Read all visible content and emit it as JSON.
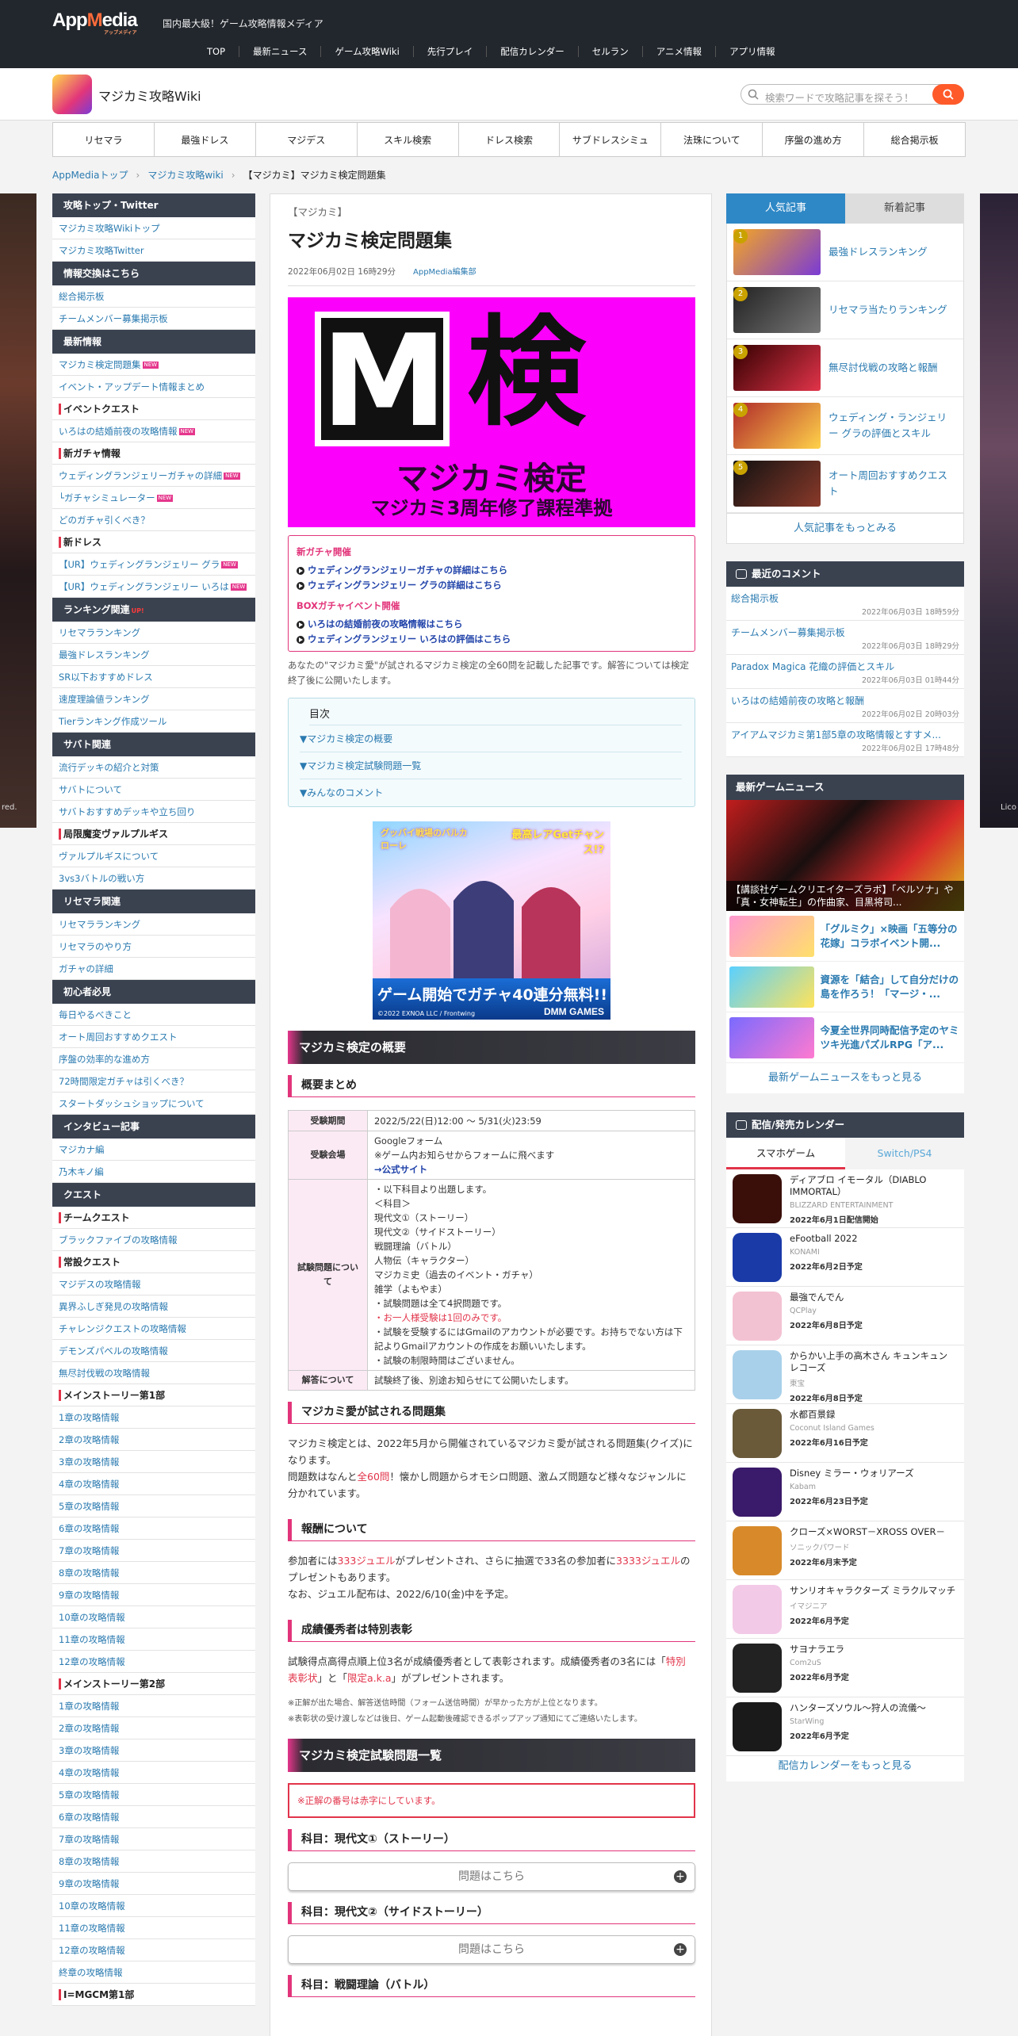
{
  "header": {
    "logo": "AppMedia",
    "logo_sub": "アップメディア",
    "tagline": "国内最大級！ゲーム攻略情報メディア",
    "nav": [
      "TOP",
      "最新ニュース",
      "ゲーム攻略Wiki",
      "先行プレイ",
      "配信カレンダー",
      "セルラン",
      "アニメ情報",
      "アプリ情報"
    ]
  },
  "site": {
    "title": "マジカミ攻略Wiki",
    "search_placeholder": "検索ワードで攻略記事を探そう！"
  },
  "wikinav": [
    "リセマラ",
    "最強ドレス",
    "マジデス",
    "スキル検索",
    "ドレス検索",
    "サブドレスシミュ",
    "法珠について",
    "序盤の進め方",
    "総合掲示板"
  ],
  "breadcrumb": [
    "AppMediaトップ",
    "マジカミ攻略wiki",
    "【マジカミ】マジカミ検定問題集"
  ],
  "art": {
    "left": "red.",
    "right": "Lico"
  },
  "left": [
    {
      "t": "h",
      "v": "攻略トップ・Twitter"
    },
    {
      "t": "l",
      "v": "マジカミ攻略Wikiトップ"
    },
    {
      "t": "l",
      "v": "マジカミ攻略Twitter"
    },
    {
      "t": "h",
      "v": "情報交換はこちら"
    },
    {
      "t": "l",
      "v": "総合掲示板"
    },
    {
      "t": "l",
      "v": "チームメンバー募集掲示板"
    },
    {
      "t": "h",
      "v": "最新情報"
    },
    {
      "t": "l",
      "v": "マジカミ検定問題集",
      "n": 1
    },
    {
      "t": "l",
      "v": "イベント・アップデート情報まとめ"
    },
    {
      "t": "s",
      "v": "イベントクエスト"
    },
    {
      "t": "l",
      "v": "いろはの結婚前夜の攻略情報",
      "n": 1
    },
    {
      "t": "s",
      "v": "新ガチャ情報"
    },
    {
      "t": "l",
      "v": "ウェディングランジェリーガチャの詳細",
      "n": 1
    },
    {
      "t": "l",
      "v": "└ガチャシミュレーター",
      "n": 1
    },
    {
      "t": "l",
      "v": "どのガチャ引くべき？"
    },
    {
      "t": "s",
      "v": "新ドレス"
    },
    {
      "t": "l",
      "v": "【UR】ウェディングランジェリー グラ",
      "n": 1
    },
    {
      "t": "l",
      "v": "【UR】ウェディングランジェリー いろは",
      "n": 1
    },
    {
      "t": "h",
      "v": "ランキング関連",
      "u": "UP!"
    },
    {
      "t": "l",
      "v": "リセマラランキング"
    },
    {
      "t": "l",
      "v": "最強ドレスランキング"
    },
    {
      "t": "l",
      "v": "SR以下おすすめドレス"
    },
    {
      "t": "l",
      "v": "速度理論値ランキング"
    },
    {
      "t": "l",
      "v": "Tierランキング作成ツール"
    },
    {
      "t": "h",
      "v": "サバト関連"
    },
    {
      "t": "l",
      "v": "流行デッキの紹介と対策"
    },
    {
      "t": "l",
      "v": "サバトについて"
    },
    {
      "t": "l",
      "v": "サバトおすすめデッキや立ち回り"
    },
    {
      "t": "s",
      "v": "局限魔変ヴァルプルギス"
    },
    {
      "t": "l",
      "v": "ヴァルプルギスについて"
    },
    {
      "t": "l",
      "v": "3vs3バトルの戦い方"
    },
    {
      "t": "h",
      "v": "リセマラ関連"
    },
    {
      "t": "l",
      "v": "リセマラランキング"
    },
    {
      "t": "l",
      "v": "リセマラのやり方"
    },
    {
      "t": "l",
      "v": "ガチャの詳細"
    },
    {
      "t": "h",
      "v": "初心者必見"
    },
    {
      "t": "l",
      "v": "毎日やるべきこと"
    },
    {
      "t": "l",
      "v": "オート周回おすすめクエスト"
    },
    {
      "t": "l",
      "v": "序盤の効率的な進め方"
    },
    {
      "t": "l",
      "v": "72時間限定ガチャは引くべき？"
    },
    {
      "t": "l",
      "v": "スタートダッシュショップについて"
    },
    {
      "t": "h",
      "v": "インタビュー記事"
    },
    {
      "t": "l",
      "v": "マジカナ編"
    },
    {
      "t": "l",
      "v": "乃木キノ編"
    },
    {
      "t": "h",
      "v": "クエスト"
    },
    {
      "t": "s",
      "v": "チームクエスト"
    },
    {
      "t": "l",
      "v": "ブラックファイブの攻略情報"
    },
    {
      "t": "s",
      "v": "常設クエスト"
    },
    {
      "t": "l",
      "v": "マジデスの攻略情報"
    },
    {
      "t": "l",
      "v": "異界ふしぎ発見の攻略情報"
    },
    {
      "t": "l",
      "v": "チャレンジクエストの攻略情報"
    },
    {
      "t": "l",
      "v": "デモンズパベルの攻略情報"
    },
    {
      "t": "l",
      "v": "無尽討伐戦の攻略情報"
    },
    {
      "t": "s",
      "v": "メインストーリー第1部"
    },
    {
      "t": "l",
      "v": "1章の攻略情報"
    },
    {
      "t": "l",
      "v": "2章の攻略情報"
    },
    {
      "t": "l",
      "v": "3章の攻略情報"
    },
    {
      "t": "l",
      "v": "4章の攻略情報"
    },
    {
      "t": "l",
      "v": "5章の攻略情報"
    },
    {
      "t": "l",
      "v": "6章の攻略情報"
    },
    {
      "t": "l",
      "v": "7章の攻略情報"
    },
    {
      "t": "l",
      "v": "8章の攻略情報"
    },
    {
      "t": "l",
      "v": "9章の攻略情報"
    },
    {
      "t": "l",
      "v": "10章の攻略情報"
    },
    {
      "t": "l",
      "v": "11章の攻略情報"
    },
    {
      "t": "l",
      "v": "12章の攻略情報"
    },
    {
      "t": "s",
      "v": "メインストーリー第2部"
    },
    {
      "t": "l",
      "v": "1章の攻略情報"
    },
    {
      "t": "l",
      "v": "2章の攻略情報"
    },
    {
      "t": "l",
      "v": "3章の攻略情報"
    },
    {
      "t": "l",
      "v": "4章の攻略情報"
    },
    {
      "t": "l",
      "v": "5章の攻略情報"
    },
    {
      "t": "l",
      "v": "6章の攻略情報"
    },
    {
      "t": "l",
      "v": "7章の攻略情報"
    },
    {
      "t": "l",
      "v": "8章の攻略情報"
    },
    {
      "t": "l",
      "v": "9章の攻略情報"
    },
    {
      "t": "l",
      "v": "10章の攻略情報"
    },
    {
      "t": "l",
      "v": "11章の攻略情報"
    },
    {
      "t": "l",
      "v": "12章の攻略情報"
    },
    {
      "t": "l",
      "v": "終章の攻略情報"
    },
    {
      "t": "s",
      "v": "I=MGCM第1部"
    }
  ],
  "article": {
    "category": "【マジカミ】",
    "title": "マジカミ検定問題集",
    "date": "2022年06月02日 16時29分",
    "author": "AppMedia編集部",
    "hero": {
      "m": "M",
      "k": "検",
      "t1": "マジカミ検定",
      "t2": "マジカミ3周年修了課程準拠"
    },
    "news": {
      "h1": "新ガチャ開催",
      "i1": "ウェディングランジェリーガチャの詳細はこちら",
      "i2": "ウェディングランジェリー グラの詳細はこちら",
      "h2": "BOXガチャイベント開催",
      "i3": "いろはの結婚前夜の攻略情報はこちら",
      "i4": "ウェディングランジェリー いろはの評価はこちら"
    },
    "intro": "あなたの\"マジカミ愛\"が試されるマジカミ検定の全60問を記載した記事です。解答については検定終了後に公開いたします。",
    "toc": {
      "head": "目次",
      "items": [
        "▼マジカミ検定の概要",
        "▼マジカミ検定試験問題一覧",
        "▼みんなのコメント"
      ]
    },
    "banner": {
      "t1": "グッバイ戦場のバルカローレ",
      "t2": "最高レアGetチャンス!?",
      "bottom": "ゲーム開始でガチャ40連分無料!!",
      "copy": "©2022 EXNOA LLC / Frontwing",
      "brand": "DMM GAMES"
    },
    "h2a": "マジカミ検定の概要",
    "h3a": "概要まとめ",
    "table": {
      "k1": "受験期間",
      "v1": "2022/5/22(日)12:00 ～ 5/31(火)23:59",
      "k2": "受験会場",
      "v2a": "Googleフォーム",
      "v2b": "※ゲーム内お知らせからフォームに飛べます",
      "v2c": "→公式サイト",
      "k3": "試験問題について",
      "v3": [
        "・以下科目より出題します。",
        "＜科目＞",
        "現代文①（ストーリー）",
        "現代文②（サイドストーリー）",
        "戦闘理論（バトル）",
        "人物伝（キャラクター）",
        "マジカミ史（過去のイベント・ガチャ）",
        "雑学（よもやま）",
        "・試験問題は全て4択問題です。"
      ],
      "v3r": "・お一人様受験は1回のみです。",
      "v3b": [
        "・試験を受験するにはGmailのアカウントが必要です。お持ちでない方は下記よりGmailアカウントの作成をお願いいたします。",
        "・試験の制限時間はございません。"
      ],
      "k4": "解答について",
      "v4": "試験終了後、別途お知らせにて公開いたします。"
    },
    "h3b": "マジカミ愛が試される問題集",
    "p1a": "マジカミ検定とは、2022年5月から開催されているマジカミ愛が試される問題集(クイズ)になります。",
    "p1b": "問題数はなんと",
    "p1r": "全60問",
    "p1c": "！懐かし問題からオモシロ問題、激ムズ問題など様々なジャンルに分かれています。",
    "h3c": "報酬について",
    "p2a": "参加者には",
    "p2r1": "333ジュエル",
    "p2b": "がプレゼントされ、さらに抽選で33名の参加者に",
    "p2r2": "3333ジュエル",
    "p2c": "のプレゼントもあります。",
    "p2d": "なお、ジュエル配布は、2022/6/10(金)中を予定。",
    "h3d": "成績優秀者は特別表彰",
    "p3a": "試験得点高得点順上位3名が成績優秀者として表彰されます。成績優秀者の3名には「",
    "p3r1": "特別表彰状",
    "p3b": "」と「",
    "p3r2": "限定a.k.a",
    "p3c": "」がプレゼントされます。",
    "n1": "※正解が出た場合、解答送信時間（フォーム送信時間）が早かった方が上位となります。",
    "n2": "※表彰状の受け渡しなどは後日、ゲーム起動後確認できるポップアップ通知にてご連絡いたします。",
    "h2b": "マジカミ検定試験問題一覧",
    "attn": "※正解の番号は赤字にしています。",
    "s1": "科目：現代文①（ストーリー）",
    "s2": "科目：現代文②（サイドストーリー）",
    "s3": "科目：戦闘理論（バトル）",
    "acc": "問題はこちら"
  },
  "right": {
    "tabs": [
      "人気記事",
      "新着記事"
    ],
    "rank": [
      {
        "n": "1",
        "t": "最強ドレスランキング"
      },
      {
        "n": "2",
        "t": "リセマラ当たりランキング"
      },
      {
        "n": "3",
        "t": "無尽討伐戦の攻略と報酬"
      },
      {
        "n": "4",
        "t": "ウェディング・ランジェリー グラの評価とスキル"
      },
      {
        "n": "5",
        "t": "オート周回おすすめクエスト"
      }
    ],
    "rank_more": "人気記事をもっとみる",
    "comments_head": "最近のコメント",
    "comments": [
      {
        "t": "総合掲示板",
        "d": "2022年06月03日 18時59分"
      },
      {
        "t": "チームメンバー募集掲示板",
        "d": "2022年06月03日 18時29分"
      },
      {
        "t": "Paradox Magica 花織の評価とスキル",
        "d": "2022年06月03日 01時44分"
      },
      {
        "t": "いろはの結婚前夜の攻略と報酬",
        "d": "2022年06月02日 20時03分"
      },
      {
        "t": "アイアムマジカミ第1部5章の攻略情報とすすメ...",
        "d": "2022年06月02日 17時48分"
      }
    ],
    "gnews_head": "最新ゲームニュース",
    "gnews_main": "【講談社ゲームクリエイターズラボ】「ベルソナ」や「真・女神転生」の作曲家、目黒将司...",
    "gnews": [
      "「グルミク」×映画「五等分の花嫁」コラボイベント開...",
      "資源を「結合」して自分だけの島を作ろう！「マージ・...",
      "今夏全世界同時配信予定のヤミツキ光進パズルRPG「ア..."
    ],
    "gnews_more": "最新ゲームニュースをもっと見る",
    "cal_head": "配信/発売カレンダー",
    "cal_tabs": [
      "スマホゲーム",
      "Switch/PS4"
    ],
    "cal": [
      {
        "n": "ディアブロ イモータル（DIABLO IMMORTAL）",
        "p": "BLIZZARD ENTERTAINMENT",
        "d": "2022年6月1日配信開始"
      },
      {
        "n": "eFootball 2022",
        "p": "KONAMI",
        "d": "2022年6月2日予定"
      },
      {
        "n": "最強でんでん",
        "p": "QCPlay",
        "d": "2022年6月8日予定"
      },
      {
        "n": "からかい上手の高木さん キュンキュンレコーズ",
        "p": "東宝",
        "d": "2022年6月8日予定"
      },
      {
        "n": "水都百景録",
        "p": "Coconut Island Games",
        "d": "2022年6月16日予定"
      },
      {
        "n": "Disney ミラー・ウォリアーズ",
        "p": "Kabam",
        "d": "2022年6月23日予定"
      },
      {
        "n": "クローズ×WORST－XROSS OVER－",
        "p": "ソニックパワード",
        "d": "2022年6月末予定"
      },
      {
        "n": "サンリオキャラクターズ ミラクルマッチ",
        "p": "イマジニア",
        "d": "2022年6月予定"
      },
      {
        "n": "サヨナラエラ",
        "p": "Com2uS",
        "d": "2022年6月予定"
      },
      {
        "n": "ハンターズソウル～狩人の流儀～",
        "p": "StarWing",
        "d": "2022年6月予定"
      }
    ],
    "cal_more": "配信カレンダーをもっと見る"
  },
  "colors": {
    "accent": "#e2347a",
    "nav_bg": "#22272d",
    "link": "#2a7ab0",
    "hero": "#fb00fb"
  }
}
